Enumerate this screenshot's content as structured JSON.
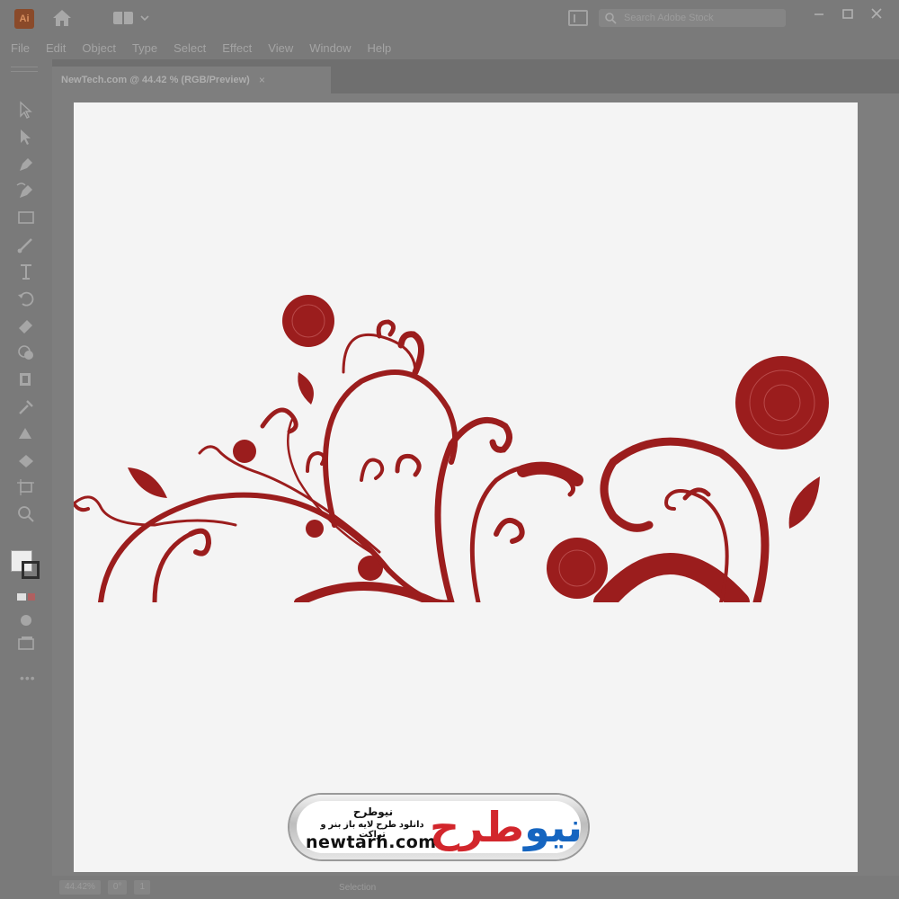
{
  "app": {
    "logo_text": "Ai"
  },
  "search": {
    "placeholder": "Search Adobe Stock"
  },
  "menu": [
    "File",
    "Edit",
    "Object",
    "Type",
    "Select",
    "Effect",
    "View",
    "Window",
    "Help"
  ],
  "document": {
    "tab_label": "NewTech.com @ 44.42 % (RGB/Preview)",
    "close_glyph": "×"
  },
  "status": {
    "zoom": "44.42%",
    "rotation": "0°",
    "artboard": "1",
    "tool": "Selection",
    "toolbar_more": "•••"
  },
  "watermark": {
    "title": "نیوطرح",
    "subtitle": "دانلود طرح لایه باز بنر و تراکت",
    "url": "newtarh.com",
    "logo_part1": "نیو",
    "logo_part2": "طرح"
  },
  "colors": {
    "ornament": "#9b1d1d",
    "chrome": "#7a7a7a",
    "artboard": "#f4f4f4"
  },
  "icons": {
    "tools": [
      "selection-tool-icon",
      "direct-selection-tool-icon",
      "pen-tool-icon",
      "curvature-tool-icon",
      "rectangle-tool-icon",
      "paintbrush-tool-icon",
      "type-tool-icon",
      "rotate-tool-icon",
      "eraser-tool-icon",
      "shape-builder-tool-icon",
      "width-tool-icon",
      "eyedropper-tool-icon",
      "gradient-tool-icon",
      "blend-tool-icon",
      "artboard-tool-icon",
      "zoom-tool-icon"
    ]
  }
}
